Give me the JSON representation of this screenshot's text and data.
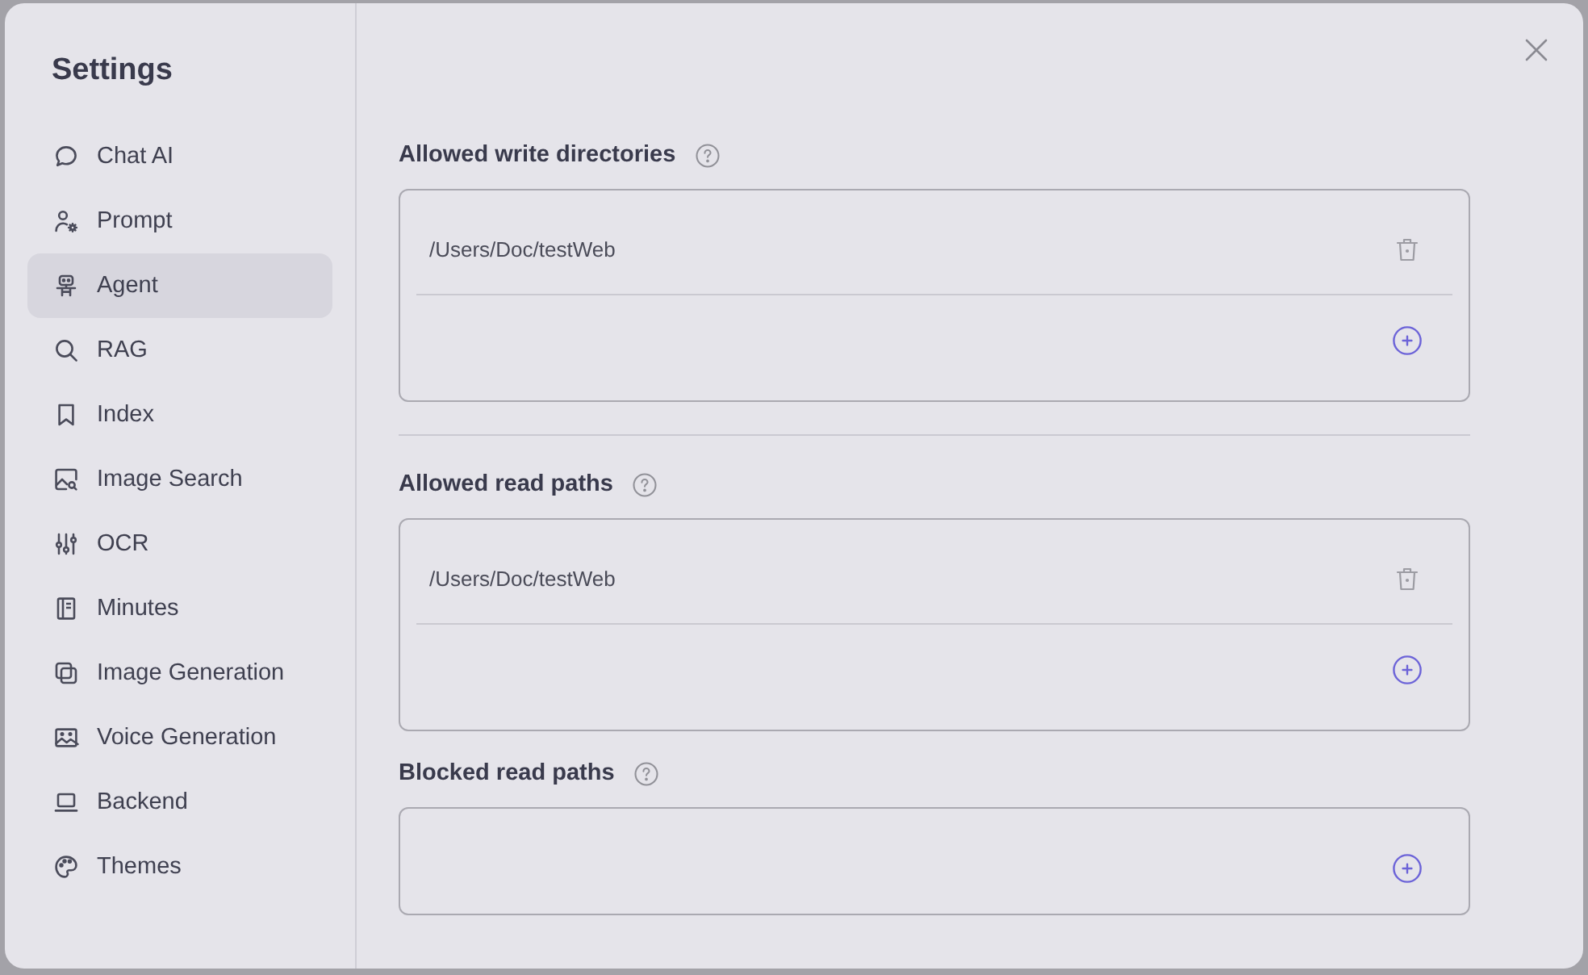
{
  "sidebar": {
    "title": "Settings",
    "items": [
      {
        "label": "Chat AI",
        "selected": false
      },
      {
        "label": "Prompt",
        "selected": false
      },
      {
        "label": "Agent",
        "selected": true
      },
      {
        "label": "RAG",
        "selected": false
      },
      {
        "label": "Index",
        "selected": false
      },
      {
        "label": "Image Search",
        "selected": false
      },
      {
        "label": "OCR",
        "selected": false
      },
      {
        "label": "Minutes",
        "selected": false
      },
      {
        "label": "Image Generation",
        "selected": false
      },
      {
        "label": "Voice Generation",
        "selected": false
      },
      {
        "label": "Backend",
        "selected": false
      },
      {
        "label": "Themes",
        "selected": false
      }
    ]
  },
  "content": {
    "groups": [
      {
        "sections": [
          {
            "title": "Allowed write directories",
            "entries": [
              {
                "path": "/Users/Doc/testWeb"
              }
            ]
          }
        ]
      },
      {
        "sections": [
          {
            "title": "Allowed read paths",
            "entries": [
              {
                "path": "/Users/Doc/testWeb"
              }
            ]
          },
          {
            "title": "Blocked read paths"
          }
        ]
      }
    ]
  }
}
